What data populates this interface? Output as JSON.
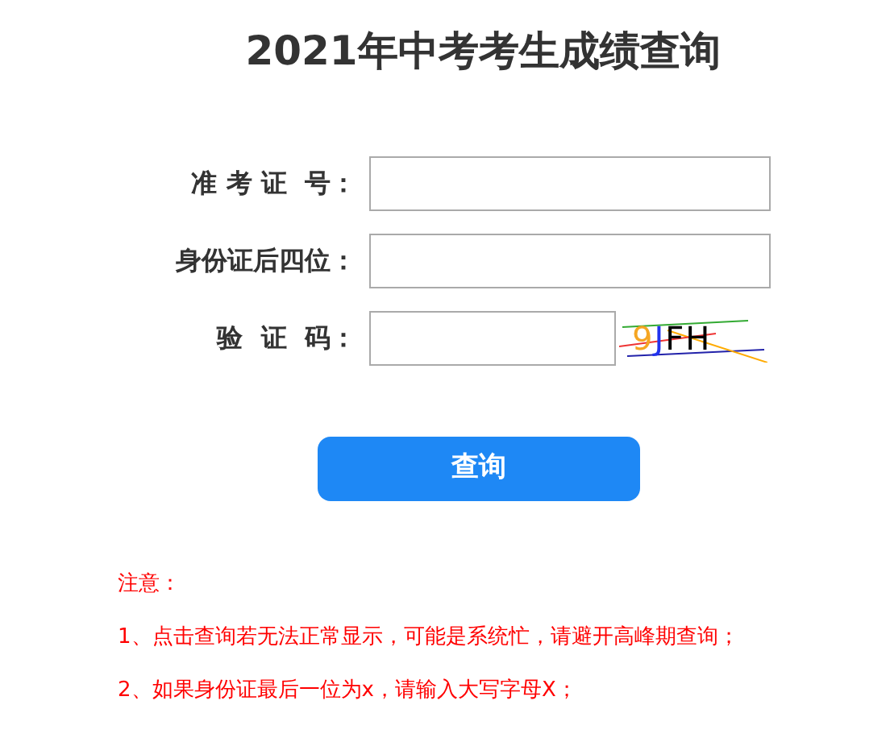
{
  "title": "2021年中考考生成绩查询",
  "fields": [
    {
      "label": "准 考 证  号：",
      "kind": "text"
    },
    {
      "label": "身份证后四位：",
      "kind": "text"
    },
    {
      "label": "验  证  码：",
      "kind": "captcha",
      "captcha": "9JFH"
    }
  ],
  "submit": "查询",
  "notes": [
    "注意：",
    "1、点击查询若无法正常显示，可能是系统忙，请避开高峰期查询；",
    "2、如果身份证最后一位为x，请输入大写字母X；"
  ]
}
